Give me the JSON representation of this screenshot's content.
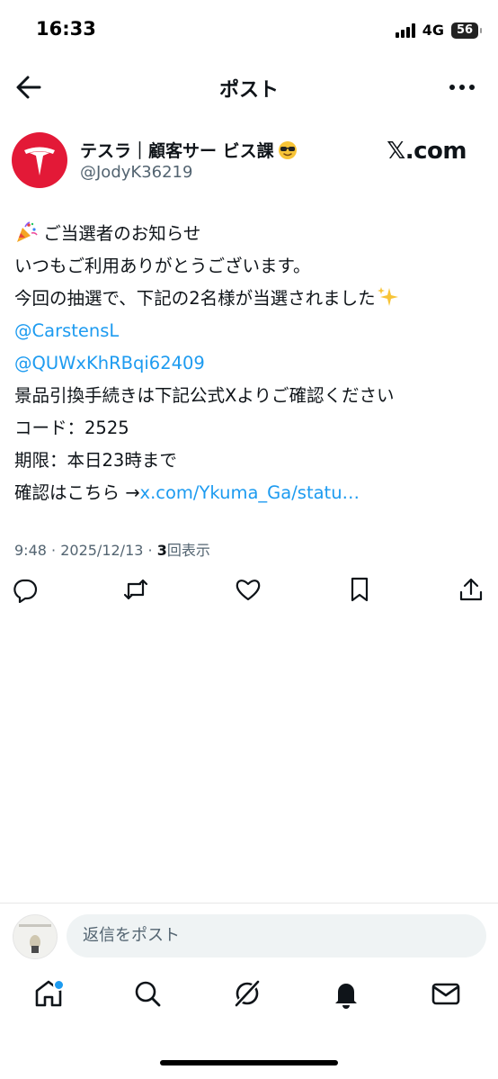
{
  "status_bar": {
    "time": "16:33",
    "network": "4G",
    "battery": "56"
  },
  "nav": {
    "title": "ポスト"
  },
  "author": {
    "name": "テスラ｜顧客サー ビス課",
    "handle": "@JodyK36219",
    "brand": "𝕏.com"
  },
  "post": {
    "line1": "ご当選者のお知らせ",
    "line2": "いつもご利用ありがとうございます。",
    "line3": "今回の抽選で、下記の2名様が当選されました",
    "mention1": "@CarstensL",
    "mention2": "@QUWxKhRBqi62409",
    "line6": "景品引換手続きは下記公式Xよりご確認ください",
    "line7": "コード：2525",
    "line8": "期限：本日23時まで",
    "line9_prefix": "確認はこちら →",
    "line9_link": "x.com/Ykuma_Ga/statu…"
  },
  "meta": {
    "time": "9:48",
    "date": "2025/12/13",
    "views_count": "3",
    "views_label": "回表示",
    "sep": " · "
  },
  "reply": {
    "placeholder": "返信をポスト"
  },
  "colors": {
    "accent": "#1d9bf0",
    "tesla_red": "#e31937",
    "text": "#0f1419",
    "muted": "#536471"
  }
}
